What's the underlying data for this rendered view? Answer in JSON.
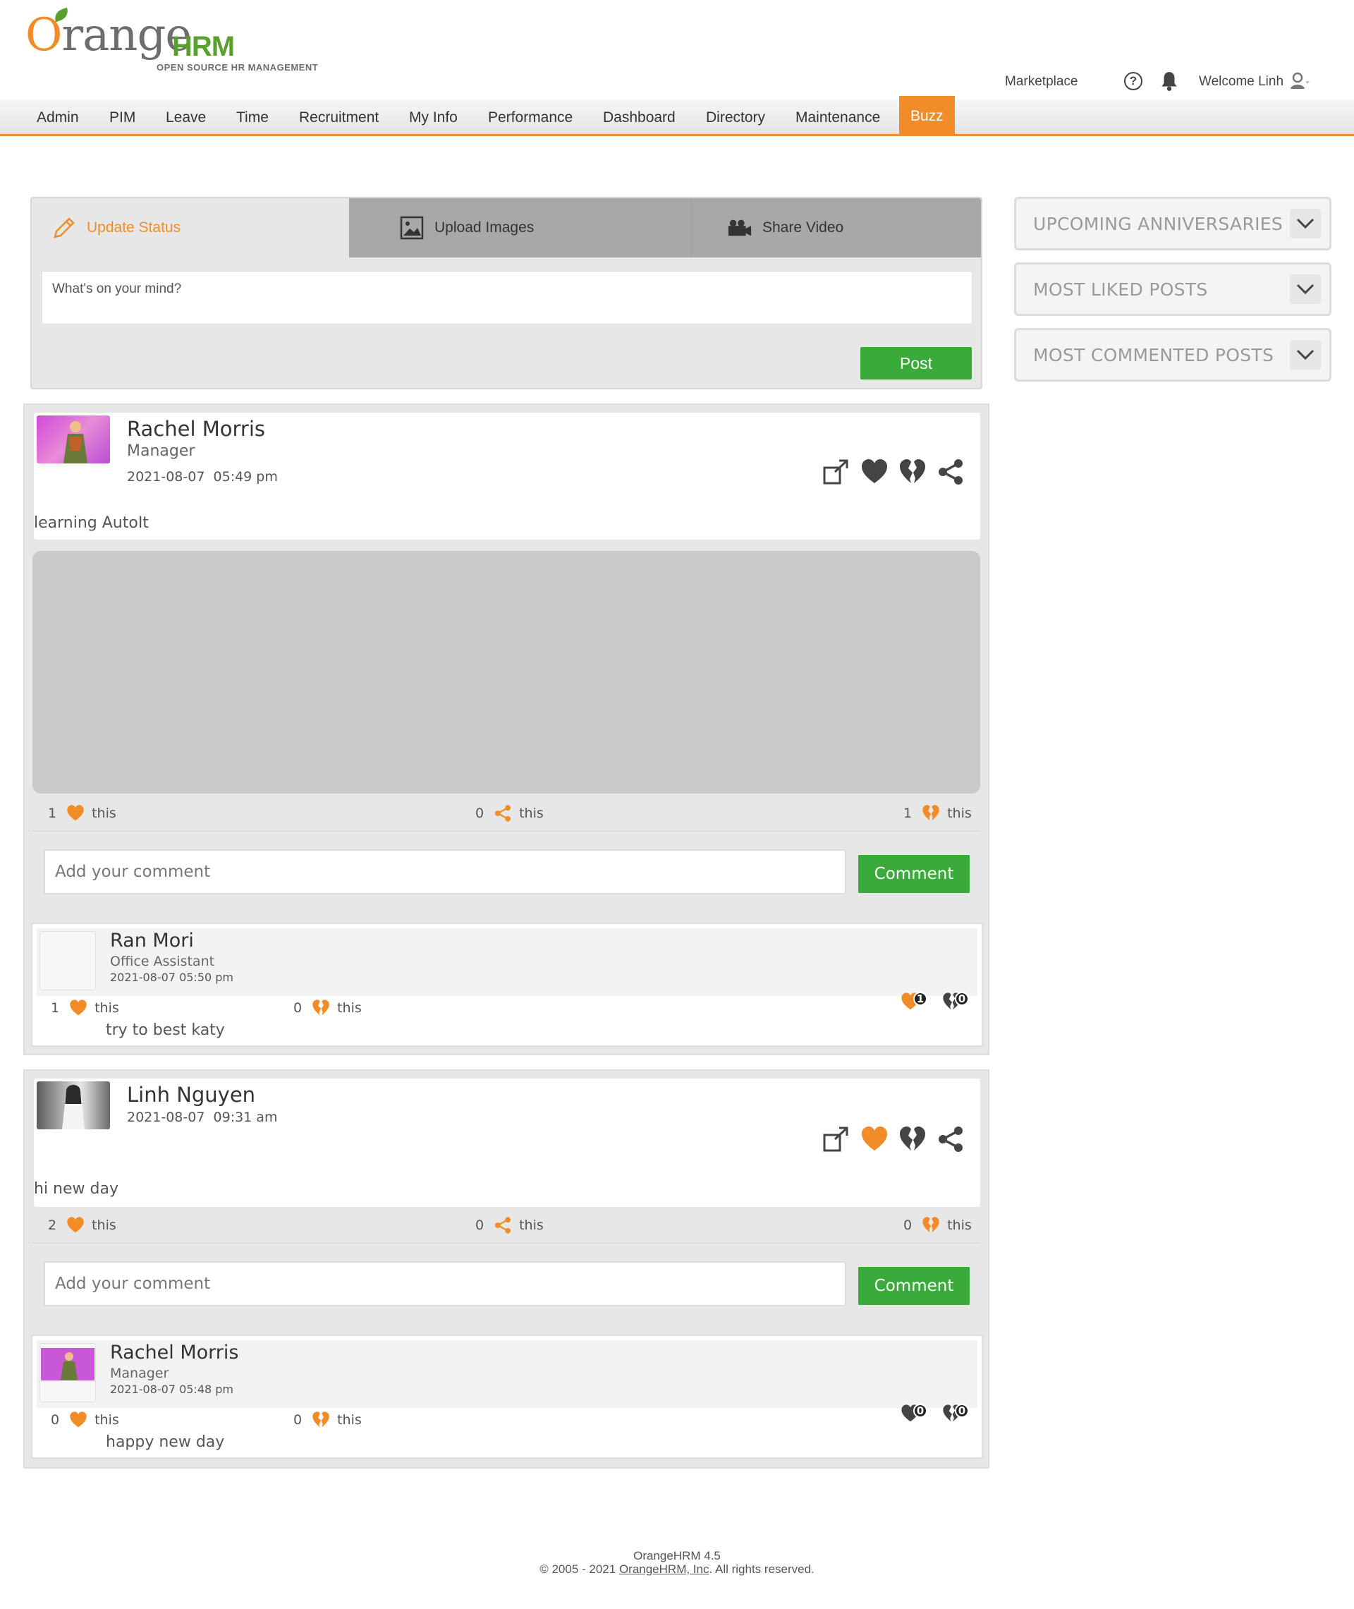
{
  "brand": {
    "name_o": "O",
    "name_rest": "range",
    "name_hrm": "HRM",
    "tagline": "OPEN SOURCE HR MANAGEMENT"
  },
  "topbar": {
    "marketplace": "Marketplace",
    "help_glyph": "?",
    "welcome": "Welcome Linh"
  },
  "nav": [
    "Admin",
    "PIM",
    "Leave",
    "Time",
    "Recruitment",
    "My Info",
    "Performance",
    "Dashboard",
    "Directory",
    "Maintenance",
    "Buzz"
  ],
  "nav_active": "Buzz",
  "composer": {
    "tabs": [
      "Update Status",
      "Upload Images",
      "Share Video"
    ],
    "placeholder": "What's on your mind?",
    "post_button": "Post"
  },
  "widgets": [
    "UPCOMING ANNIVERSARIES",
    "MOST LIKED POSTS",
    "MOST COMMENTED POSTS"
  ],
  "posts": [
    {
      "author": "Rachel Morris",
      "job": "Manager",
      "date": "2021-08-07",
      "time": "05:49 pm",
      "text": "learning AutoIt",
      "has_image": true,
      "likes": "1",
      "likes_label": "this",
      "shares": "0",
      "shares_label": "this",
      "dislikes": "1",
      "dislikes_label": "this",
      "comment_placeholder": "Add your comment",
      "comment_button": "Comment",
      "liked": false,
      "shared_post": {
        "author": "Ran Mori",
        "job": "Office Assistant",
        "datetime": "2021-08-07 05:50 pm",
        "likes": "1",
        "likes_label": "this",
        "dislikes": "0",
        "dislikes_label": "this",
        "text": "try to best katy",
        "badge_like": "1",
        "badge_dislike": "0",
        "badge_like_color": "#f28c28"
      }
    },
    {
      "author": "Linh Nguyen",
      "job": "",
      "date": "2021-08-07",
      "time": "09:31 am",
      "text": "hi new day",
      "has_image": false,
      "likes": "2",
      "likes_label": "this",
      "shares": "0",
      "shares_label": "this",
      "dislikes": "0",
      "dislikes_label": "this",
      "comment_placeholder": "Add your comment",
      "comment_button": "Comment",
      "liked": true,
      "shared_post": {
        "author": "Rachel Morris",
        "job": "Manager",
        "datetime": "2021-08-07 05:48 pm",
        "likes": "0",
        "likes_label": "this",
        "dislikes": "0",
        "dislikes_label": "this",
        "text": "happy new day",
        "badge_like": "0",
        "badge_dislike": "0",
        "badge_like_color": "#444444"
      }
    }
  ],
  "footer": {
    "version": "OrangeHRM 4.5",
    "copyright_pre": "© 2005 - 2021 ",
    "company": "OrangeHRM, Inc",
    "copyright_post": ". All rights reserved."
  },
  "colors": {
    "accent": "#f28c28",
    "green": "#3aab3a",
    "logo_green": "#5aa02c"
  }
}
